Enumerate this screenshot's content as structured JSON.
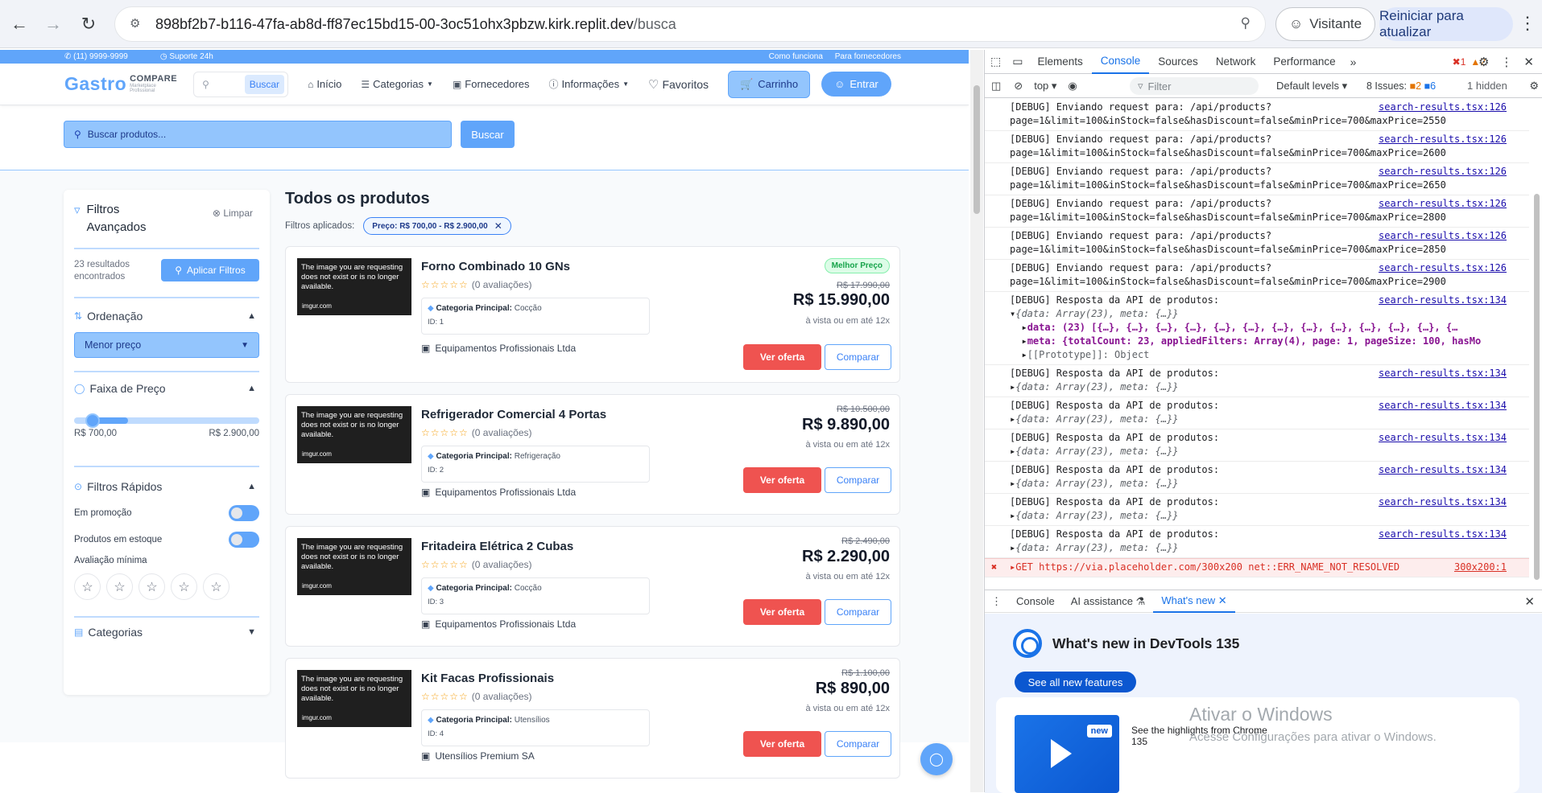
{
  "browser": {
    "url_host": "898bf2b7-b116-47fa-ab8d-ff87ec15bd15-00-3oc51ohx3pbzw.kirk.replit.dev",
    "url_path": "/busca",
    "visitor_label": "Visitante",
    "restart_label": "Reiniciar para atualizar"
  },
  "site": {
    "topbar": {
      "phone": "(11) 9999-9999",
      "support": "Suporte 24h",
      "how_it_works": "Como funciona",
      "for_suppliers": "Para fornecedores"
    },
    "logo": {
      "main": "Gastro",
      "sub": "COMPARE",
      "tag1": "Marketplace",
      "tag2": "Profissional"
    },
    "header": {
      "search_button": "Buscar",
      "nav": {
        "home": "Início",
        "categories": "Categorias",
        "suppliers": "Fornecedores",
        "info": "Informações",
        "favorites": "Favoritos",
        "cart": "Carrinho",
        "login": "Entrar"
      }
    },
    "main_search": {
      "placeholder": "Buscar produtos...",
      "button": "Buscar"
    },
    "filters": {
      "title": "Filtros Avançados",
      "clear": "Limpar",
      "results_count": "23 resultados encontrados",
      "apply": "Aplicar Filtros",
      "sort_title": "Ordenação",
      "sort_value": "Menor preço",
      "price_title": "Faixa de Preço",
      "price_min": "R$ 700,00",
      "price_max": "R$ 2.900,00",
      "quick_title": "Filtros Rápidos",
      "promo": "Em promoção",
      "in_stock": "Produtos em estoque",
      "min_rating": "Avaliação mínima",
      "categories_title": "Categorias"
    },
    "results": {
      "title": "Todos os produtos",
      "applied_label": "Filtros aplicados:",
      "chip": "Preço: R$ 700,00 - R$ 2.900,00",
      "image_error": "The image you are requesting does not exist or is no longer available.",
      "image_host": "imgur.com",
      "products": [
        {
          "name": "Forno Combinado 10 GNs",
          "rating": "(0 avaliações)",
          "cat_label": "Categoria Principal:",
          "cat": "Cocção",
          "id": "ID: 1",
          "seller": "Equipamentos Profissionais Ltda",
          "badge": "Melhor Preço",
          "old_price": "R$ 17.990,00",
          "price": "R$ 15.990,00",
          "cond": "à vista ou em até 12x",
          "offer": "Ver oferta",
          "compare": "Comparar"
        },
        {
          "name": "Refrigerador Comercial 4 Portas",
          "rating": "(0 avaliações)",
          "cat_label": "Categoria Principal:",
          "cat": "Refrigeração",
          "id": "ID: 2",
          "seller": "Equipamentos Profissionais Ltda",
          "badge": "",
          "old_price": "R$ 10.500,00",
          "price": "R$ 9.890,00",
          "cond": "à vista ou em até 12x",
          "offer": "Ver oferta",
          "compare": "Comparar"
        },
        {
          "name": "Fritadeira Elétrica 2 Cubas",
          "rating": "(0 avaliações)",
          "cat_label": "Categoria Principal:",
          "cat": "Cocção",
          "id": "ID: 3",
          "seller": "Equipamentos Profissionais Ltda",
          "badge": "",
          "old_price": "R$ 2.490,00",
          "price": "R$ 2.290,00",
          "cond": "à vista ou em até 12x",
          "offer": "Ver oferta",
          "compare": "Comparar"
        },
        {
          "name": "Kit Facas Profissionais",
          "rating": "(0 avaliações)",
          "cat_label": "Categoria Principal:",
          "cat": "Utensílios",
          "id": "ID: 4",
          "seller": "Utensílios Premium SA",
          "badge": "",
          "old_price": "R$ 1.100,00",
          "price": "R$ 890,00",
          "cond": "à vista ou em até 12x",
          "offer": "Ver oferta",
          "compare": "Comparar"
        }
      ]
    }
  },
  "devtools": {
    "tabs": [
      "Elements",
      "Console",
      "Sources",
      "Network",
      "Performance"
    ],
    "active_tab": "Console",
    "errors": "1",
    "warnings": "2",
    "context": "top",
    "filter_placeholder": "Filter",
    "levels": "Default levels",
    "issues_label": "8 Issues:",
    "issues_orange": "2",
    "issues_blue": "6",
    "hidden": "1 hidden",
    "logs": [
      {
        "l1": "[DEBUG] Enviando request para: /api/products?",
        "l2": "page=1&limit=100&inStock=false&hasDiscount=false&minPrice=700&maxPrice=2550",
        "src": "search-results.tsx:126"
      },
      {
        "l1": "[DEBUG] Enviando request para: /api/products?",
        "l2": "page=1&limit=100&inStock=false&hasDiscount=false&minPrice=700&maxPrice=2600",
        "src": "search-results.tsx:126"
      },
      {
        "l1": "[DEBUG] Enviando request para: /api/products?",
        "l2": "page=1&limit=100&inStock=false&hasDiscount=false&minPrice=700&maxPrice=2650",
        "src": "search-results.tsx:126"
      },
      {
        "l1": "[DEBUG] Enviando request para: /api/products?",
        "l2": "page=1&limit=100&inStock=false&hasDiscount=false&minPrice=700&maxPrice=2800",
        "src": "search-results.tsx:126"
      },
      {
        "l1": "[DEBUG] Enviando request para: /api/products?",
        "l2": "page=1&limit=100&inStock=false&hasDiscount=false&minPrice=700&maxPrice=2850",
        "src": "search-results.tsx:126"
      },
      {
        "l1": "[DEBUG] Enviando request para: /api/products?",
        "l2": "page=1&limit=100&inStock=false&hasDiscount=false&minPrice=700&maxPrice=2900",
        "src": "search-results.tsx:126"
      }
    ],
    "expanded": {
      "l1": "[DEBUG] Resposta da API de produtos:",
      "obj": "{data: Array(23), meta: {…}}",
      "data_line": "data: (23) [{…}, {…}, {…}, {…}, {…}, {…}, {…}, {…}, {…}, {…}, {…}, {…}, {…",
      "meta_line": "meta: {totalCount: 23, appliedFilters: Array(4), page: 1, pageSize: 100, hasMo",
      "proto_line": "[[Prototype]]: Object",
      "src": "search-results.tsx:134"
    },
    "responses": [
      {
        "l1": "[DEBUG] Resposta da API de produtos:",
        "l2": "{data: Array(23), meta: {…}}",
        "src": "search-results.tsx:134"
      },
      {
        "l1": "[DEBUG] Resposta da API de produtos:",
        "l2": "{data: Array(23), meta: {…}}",
        "src": "search-results.tsx:134"
      },
      {
        "l1": "[DEBUG] Resposta da API de produtos:",
        "l2": "{data: Array(23), meta: {…}}",
        "src": "search-results.tsx:134"
      },
      {
        "l1": "[DEBUG] Resposta da API de produtos:",
        "l2": "{data: Array(23), meta: {…}}",
        "src": "search-results.tsx:134"
      },
      {
        "l1": "[DEBUG] Resposta da API de produtos:",
        "l2": "{data: Array(23), meta: {…}}",
        "src": "search-results.tsx:134"
      },
      {
        "l1": "[DEBUG] Resposta da API de produtos:",
        "l2": "{data: Array(23), meta: {…}}",
        "src": "search-results.tsx:134"
      }
    ],
    "error_line": "GET https://via.placeholder.com/300x200 net::ERR_NAME_NOT_RESOLVED",
    "error_src": "300x200:1",
    "drawer": {
      "tabs": [
        "Console",
        "AI assistance",
        "What's new"
      ],
      "whatsnew_title": "What's new in DevTools 135",
      "see_all": "See all new features",
      "new_badge": "new",
      "highlights": "See the highlights from Chrome 135"
    }
  },
  "windows_watermark": {
    "line1": "Ativar o Windows",
    "line2": "Acesse Configurações para ativar o Windows."
  }
}
